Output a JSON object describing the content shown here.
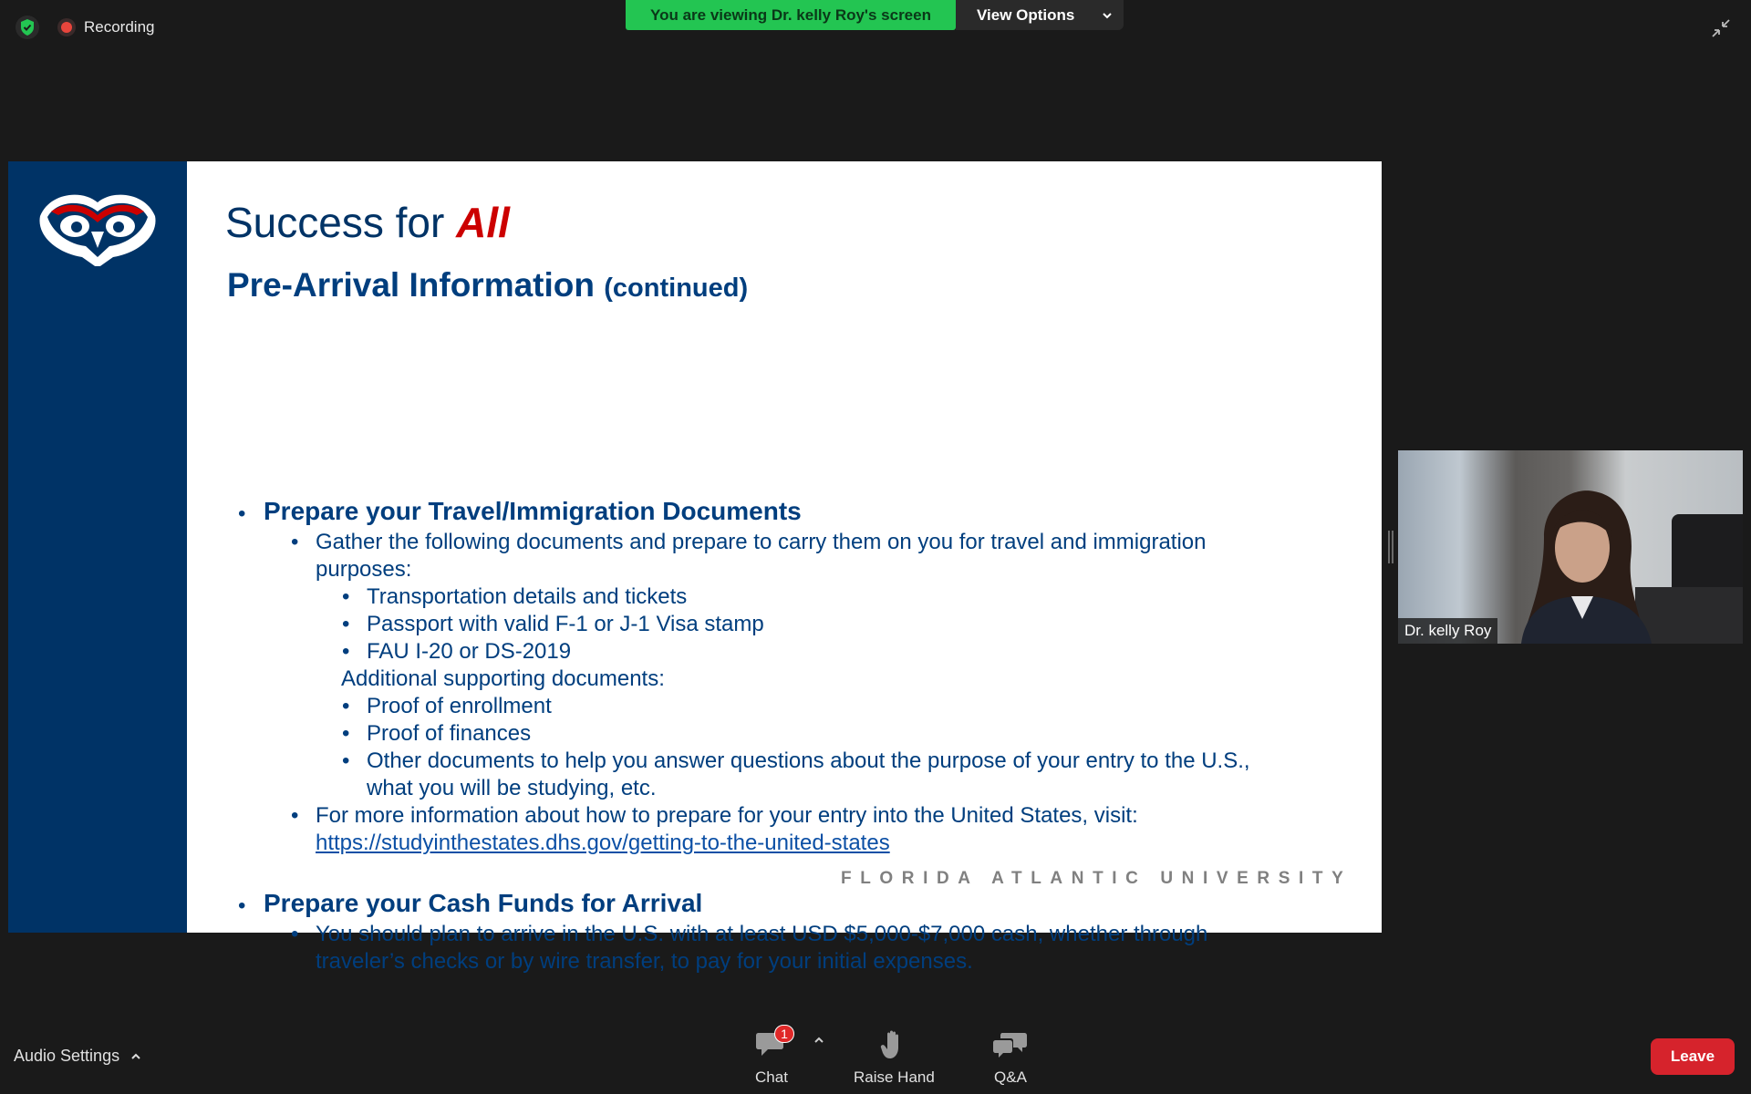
{
  "topbar": {
    "recording_label": "Recording",
    "viewing_banner": "You are viewing Dr. kelly Roy's screen",
    "view_options_label": "View Options"
  },
  "slide": {
    "title_prefix": "Success for ",
    "title_emph": "All",
    "subtitle": "Pre-Arrival Information",
    "subtitle_suffix": "(continued)",
    "sections": {
      "s1_heading": "Prepare your Travel/Immigration Documents",
      "s1_b1_line1": "Gather the following documents and prepare to carry them on you for travel and immigration",
      "s1_b1_line2": "purposes:",
      "s1_sub1": "Transportation details and tickets",
      "s1_sub2": "Passport with valid F-1 or J-1 Visa stamp",
      "s1_sub3": "FAU I-20 or DS-2019",
      "s1_additional": "Additional supporting documents:",
      "s1_sub4": "Proof of enrollment",
      "s1_sub5": "Proof of finances",
      "s1_sub6_line1": "Other documents to help you answer questions about the purpose of your entry to the U.S.,",
      "s1_sub6_line2": "what you will be studying, etc.",
      "s1_b2_line1": "For more information about how to prepare for your entry into the United States, visit:",
      "s1_link": "https://studyinthestates.dhs.gov/getting-to-the-united-states",
      "s2_heading": "Prepare your Cash Funds for Arrival",
      "s2_b1_line1": "You should plan to arrive in the U.S. with at least USD $5,000-$7,000 cash, whether through",
      "s2_b1_line2": "traveler’s checks or by wire transfer, to pay for your initial expenses."
    },
    "footer": "FLORIDA ATLANTIC UNIVERSITY"
  },
  "video": {
    "participant_name": "Dr. kelly Roy"
  },
  "bottombar": {
    "audio_settings_label": "Audio Settings",
    "chat_label": "Chat",
    "chat_badge": "1",
    "raise_hand_label": "Raise Hand",
    "qa_label": "Q&A",
    "leave_label": "Leave"
  },
  "colors": {
    "banner_green": "#23c552",
    "slide_navy": "#003366",
    "slide_red": "#cc0000",
    "leave_red": "#d6232c"
  }
}
